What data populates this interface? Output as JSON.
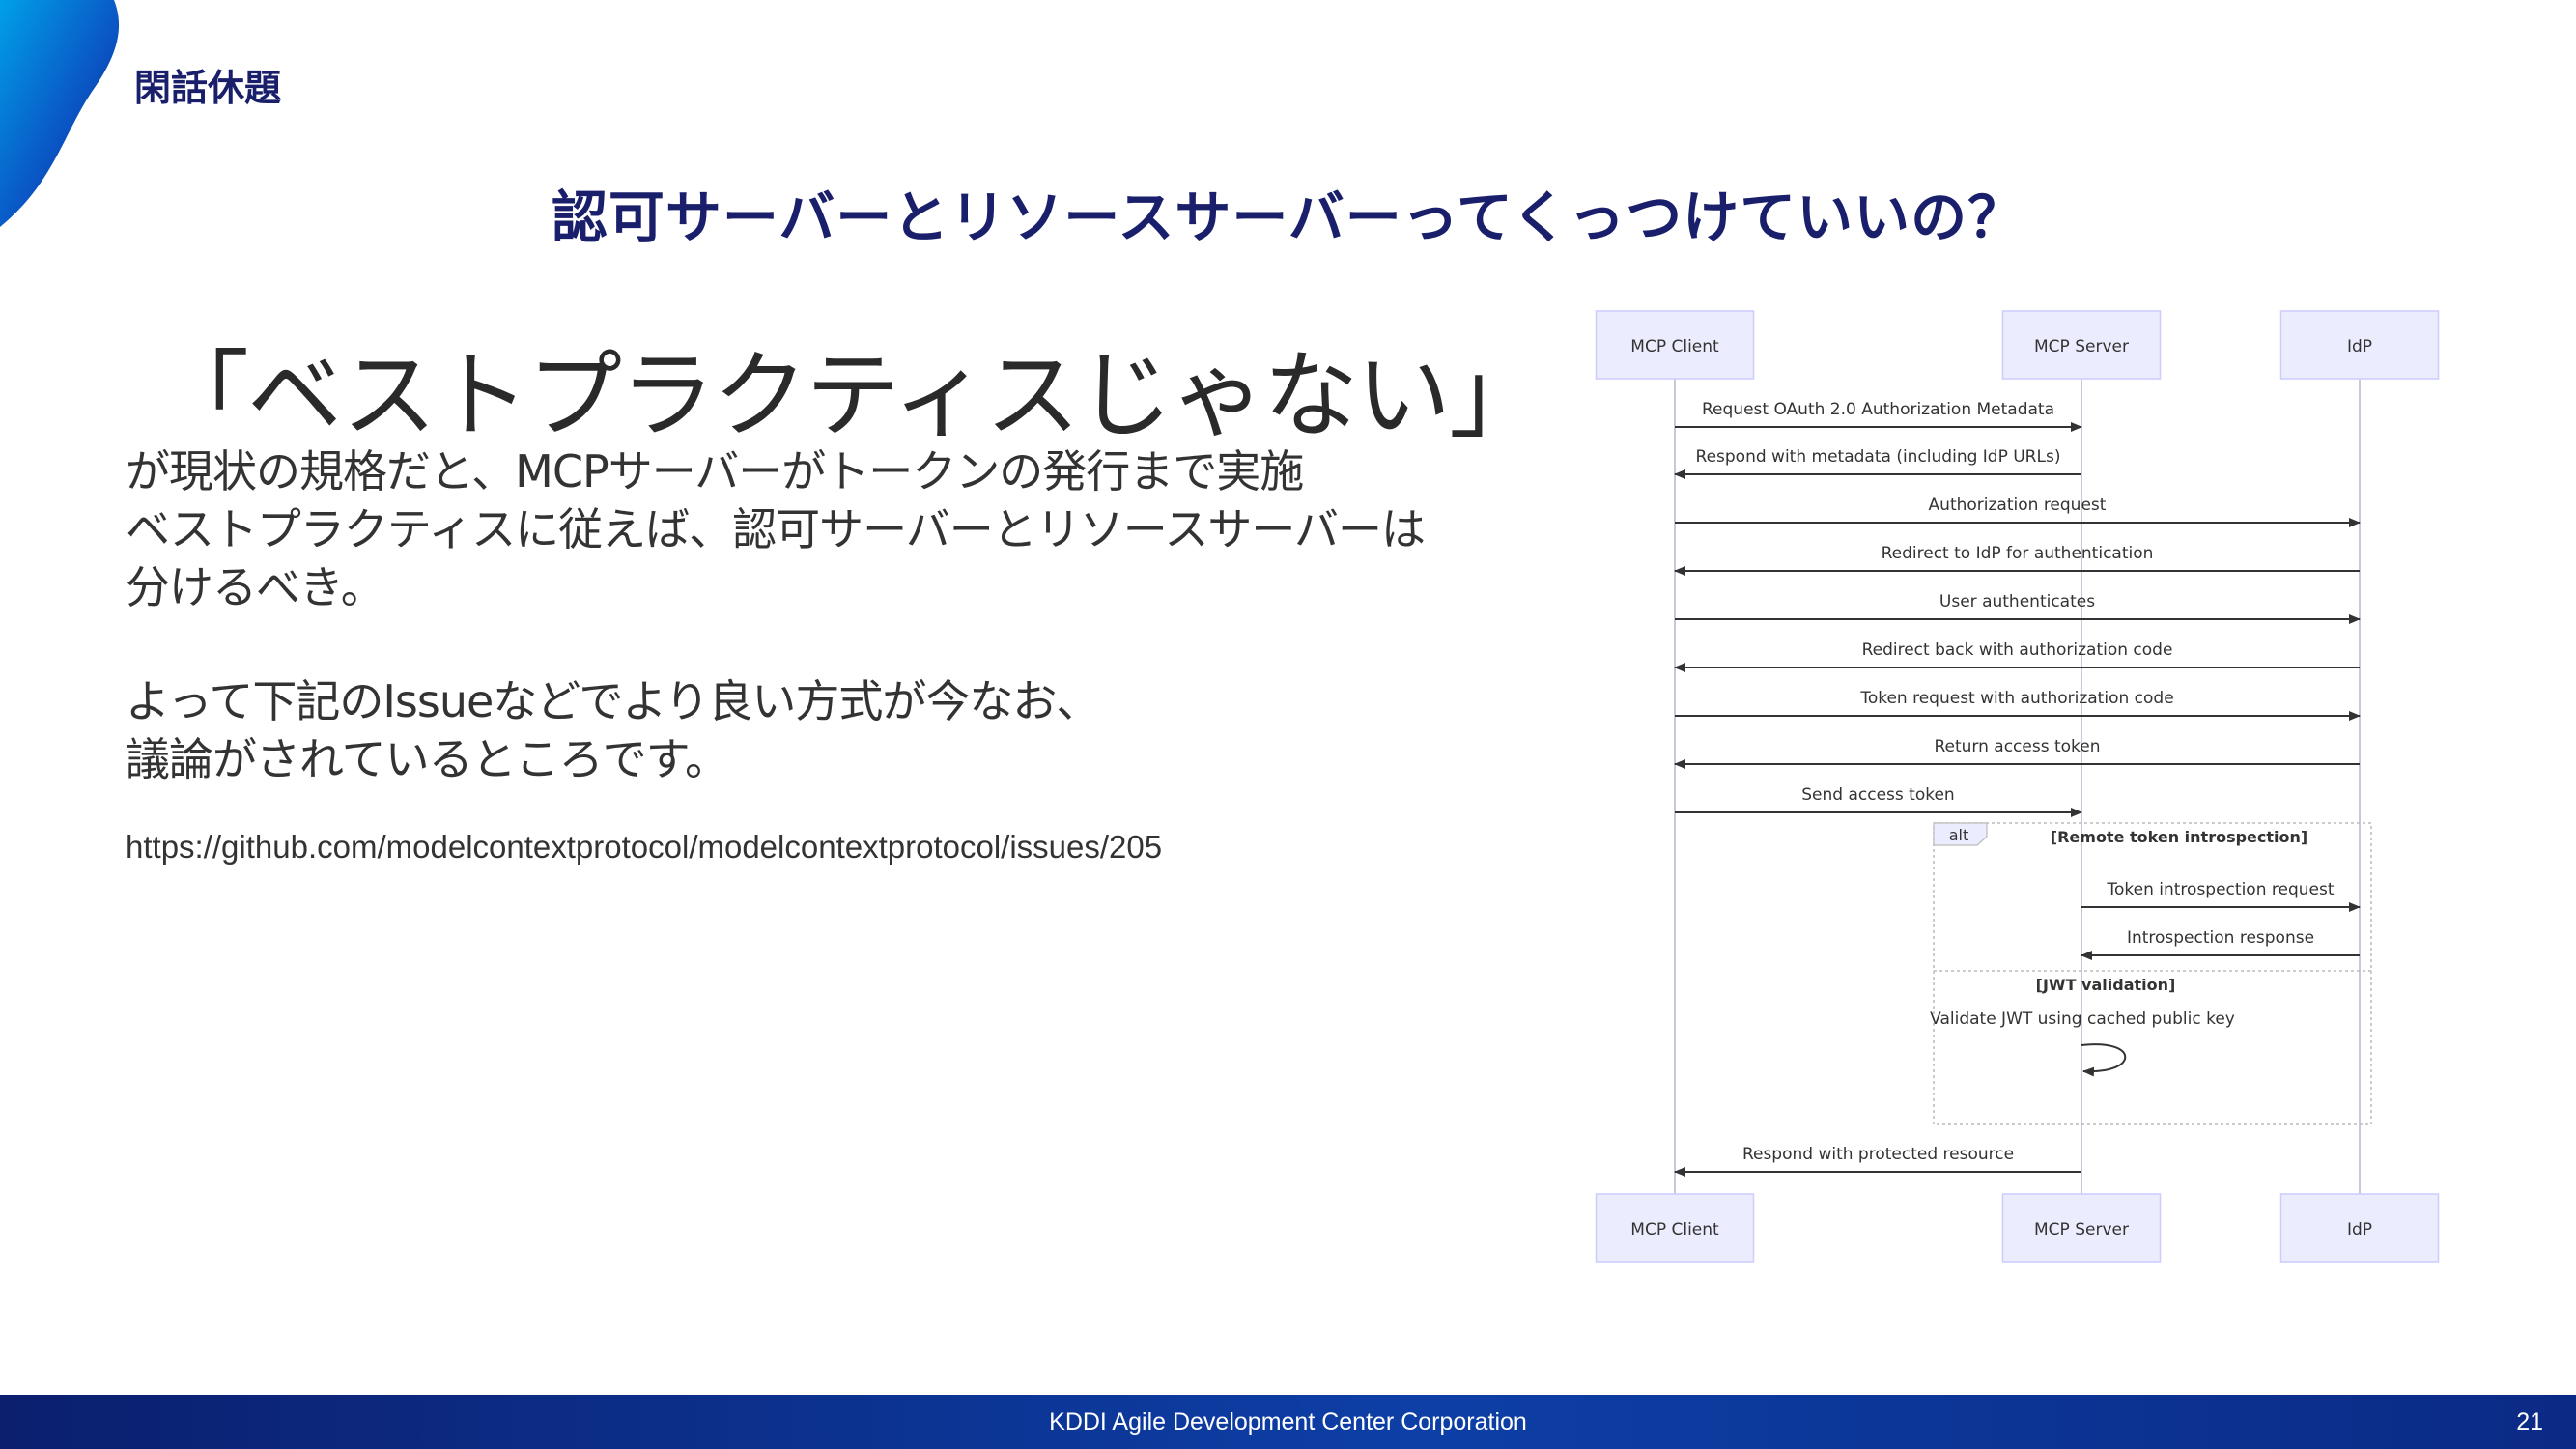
{
  "slide": {
    "section_label": "閑話休題",
    "title": "認可サーバーとリソースサーバーってくっつけていいの？",
    "headline": "「ベストプラクティスじゃない」",
    "body_lines": [
      "が現状の規格だと、MCPサーバーがトークンの発行まで実施",
      "ベストプラクティスに従えば、認可サーバーとリソースサーバーは",
      "分けるべき。",
      "",
      "よって下記のIssueなどでより良い方式が今なお、",
      "議論がされているところです。"
    ],
    "link": "https://github.com/modelcontextprotocol/modelcontextprotocol/issues/205"
  },
  "diagram": {
    "participants": [
      "MCP Client",
      "MCP Server",
      "IdP"
    ],
    "messages": [
      {
        "from": 0,
        "to": 1,
        "label": "Request OAuth 2.0 Authorization Metadata"
      },
      {
        "from": 1,
        "to": 0,
        "label": "Respond with metadata (including IdP URLs)"
      },
      {
        "from": 0,
        "to": 2,
        "label": "Authorization request"
      },
      {
        "from": 2,
        "to": 0,
        "label": "Redirect to IdP for authentication"
      },
      {
        "from": 0,
        "to": 2,
        "label": "User authenticates"
      },
      {
        "from": 2,
        "to": 0,
        "label": "Redirect back with authorization code"
      },
      {
        "from": 0,
        "to": 2,
        "label": "Token request with authorization code"
      },
      {
        "from": 2,
        "to": 0,
        "label": "Return access token"
      },
      {
        "from": 0,
        "to": 1,
        "label": "Send access token"
      },
      {
        "from": 1,
        "to": 2,
        "label": "Token introspection request"
      },
      {
        "from": 2,
        "to": 1,
        "label": "Introspection response"
      },
      {
        "from": 1,
        "to": 1,
        "label": "Validate JWT using cached public key"
      },
      {
        "from": 1,
        "to": 0,
        "label": "Respond with protected resource"
      }
    ],
    "alt_block": {
      "keyword": "alt",
      "condition": "[Remote token introspection]",
      "else_condition": "[JWT validation]"
    }
  },
  "footer": {
    "company": "KDDI Agile Development Center Corporation",
    "page": "21"
  },
  "colors": {
    "title": "#1a1f6b",
    "actor_fill": "#ececff",
    "actor_stroke": "#ccccff",
    "footer": "#0b2a85"
  }
}
